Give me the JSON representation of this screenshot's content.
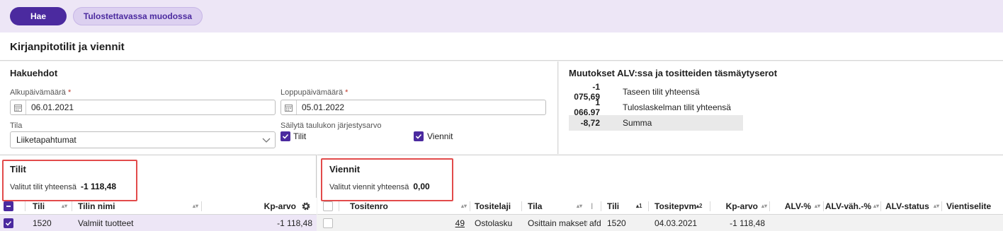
{
  "toolbar": {
    "search_label": "Hae",
    "print_label": "Tulostettavassa muodossa"
  },
  "page": {
    "title": "Kirjanpitotilit ja viennit"
  },
  "search": {
    "title": "Hakuehdot",
    "start_label": "Alkupäivämäärä",
    "start_value": "06.01.2021",
    "end_label": "Loppupäivämäärä",
    "end_value": "05.01.2022",
    "required_mark": "*",
    "state_label": "Tila",
    "state_value": "Liiketapahtumat",
    "keep_order_label": "Säilytä taulukon järjestysarvo",
    "keep_tilit": "Tilit",
    "keep_viennit": "Viennit"
  },
  "changes": {
    "title": "Muutokset ALV:ssa ja tositteiden täsmäytyserot",
    "rows": [
      {
        "value": "-1 075,69",
        "label": "Taseen tilit yhteensä"
      },
      {
        "value": "1 066,97",
        "label": "Tuloslaskelman tilit yhteensä"
      },
      {
        "value": "-8,72",
        "label": "Summa"
      }
    ]
  },
  "tilit": {
    "title": "Tilit",
    "total_label": "Valitut tilit yhteensä",
    "total_value": "-1 118,48",
    "columns": [
      "Tili",
      "Tilin nimi",
      "Kp-arvo"
    ],
    "rows": [
      {
        "tili": "1520",
        "nimi": "Valmiit tuotteet",
        "kp": "-1 118,48"
      }
    ]
  },
  "viennit": {
    "title": "Viennit",
    "total_label": "Valitut viennit yhteensä",
    "total_value": "0,00",
    "columns": {
      "tositenro": "Tositenro",
      "tositelaji": "Tositelaji",
      "tila": "Tila",
      "i": "I",
      "tili": "Tili",
      "tositepvm": "Tositepvm",
      "kp": "Kp-arvo",
      "alv": "ALV-%",
      "alvvah": "ALV-väh.-%",
      "alvstatus": "ALV-status",
      "selite": "Vientiselite"
    },
    "sort_tili": "1",
    "sort_pvm": "2",
    "rows": [
      {
        "tositenro": "49",
        "tositelaji": "Ostolasku",
        "tila": "Osittain maksettu",
        "i": "afd",
        "tili": "1520",
        "tositepvm": "04.03.2021",
        "kp": "-1 118,48"
      }
    ]
  },
  "colors": {
    "accent": "#4b2a9f",
    "highlight": "#e24b4b",
    "topbar": "#ede6f6"
  }
}
